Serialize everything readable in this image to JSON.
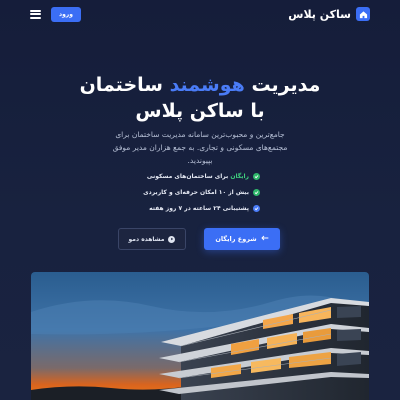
{
  "header": {
    "brand_name": "ساکن پلاس",
    "login_label": "ورود"
  },
  "hero": {
    "title_part1": "مدیریت ",
    "title_accent": "هوشمند",
    "title_part2": " ساختمان",
    "title_line2": "با ساکن پلاس",
    "description": "جامع‌ترین و محبوب‌ترین سامانه مدیریت ساختمان برای مجتمع‌های مسکونی و تجاری. به جمع هزاران مدیر موفق بپیوندید."
  },
  "features": [
    {
      "highlight": "رایگان",
      "text": " برای ساختمان‌های مسکونی",
      "icon": "check-icon",
      "color": "#2fb86b"
    },
    {
      "highlight": "",
      "text": "بیش از ۱۰ امکان حرفه‌ای و کاربردی",
      "icon": "check-icon",
      "color": "#2fb86b"
    },
    {
      "highlight": "",
      "text": "پشتیبانی ۲۴ ساعته در ۷ روز هفته",
      "icon": "check-icon",
      "color": "#4a7cf7"
    }
  ],
  "cta": {
    "start_label": "شروع رایگان",
    "demo_label": "مشاهده دمو"
  },
  "colors": {
    "accent": "#3b6ef5",
    "success": "#2fb86b",
    "background": "#151d3a"
  }
}
